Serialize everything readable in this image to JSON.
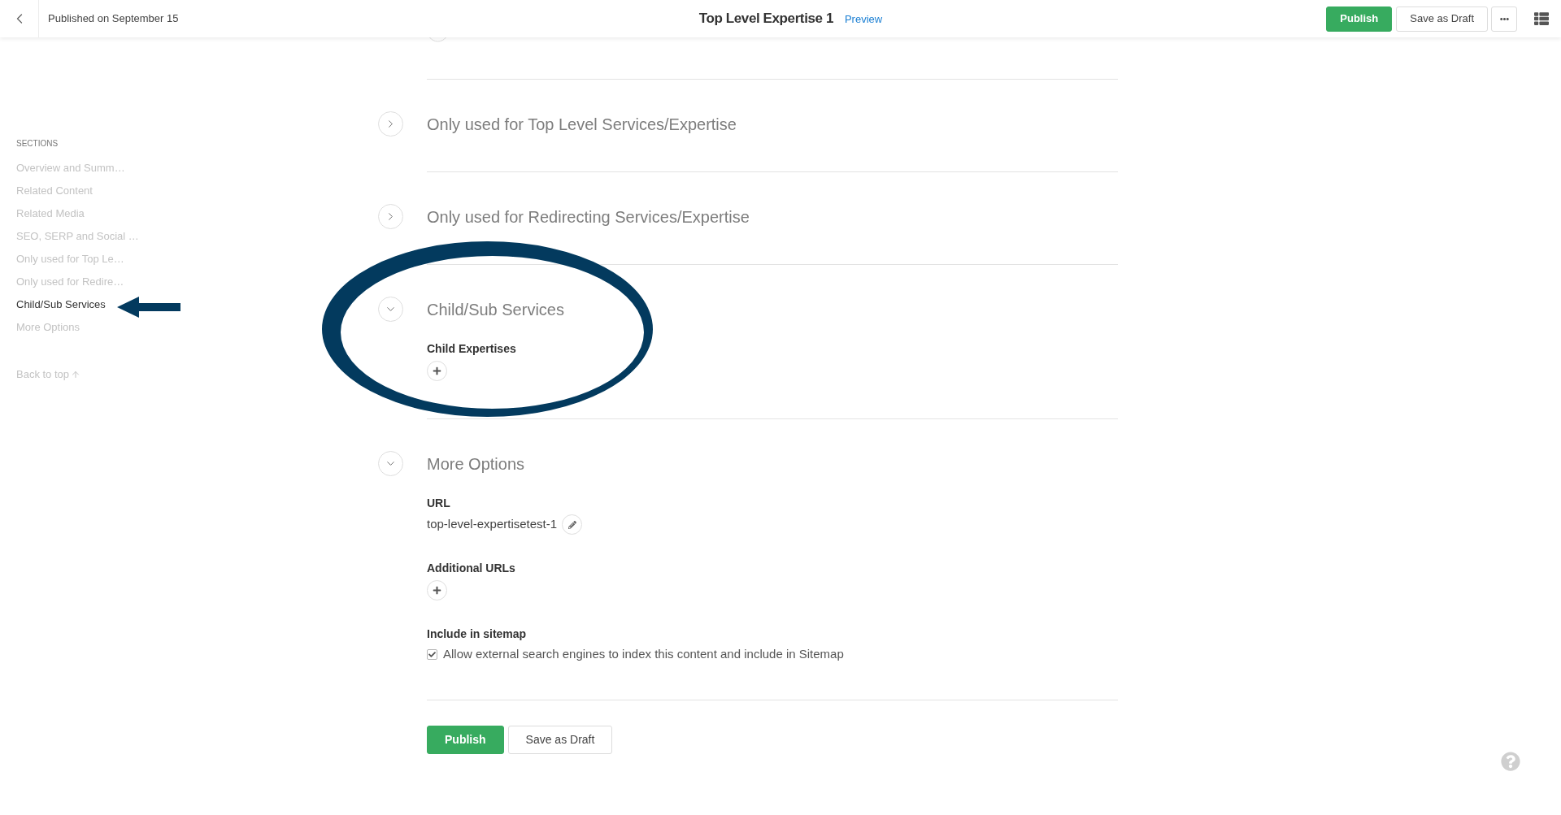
{
  "header": {
    "status": "Published on September 15",
    "title": "Top Level Expertise 1",
    "preview_link": "Preview",
    "buttons": [
      {
        "label": "Publish",
        "kind": "primary"
      },
      {
        "label": "Save as Draft",
        "kind": "secondary"
      }
    ]
  },
  "sidebar": {
    "heading": "SECTIONS",
    "items": [
      {
        "label": "Overview and Summ…",
        "selected": false
      },
      {
        "label": "Related Content",
        "selected": false
      },
      {
        "label": "Related Media",
        "selected": false
      },
      {
        "label": "SEO, SERP and Social …",
        "selected": false
      },
      {
        "label": "Only used for Top Le…",
        "selected": false
      },
      {
        "label": "Only used for Redire…",
        "selected": false
      },
      {
        "label": "Child/Sub Services",
        "selected": true
      },
      {
        "label": "More Options",
        "selected": false
      }
    ],
    "back_to_top": "Back to top"
  },
  "sections": [
    {
      "title": "Only used for Top Level Services/Expertise",
      "expanded": false
    },
    {
      "title": "Only used for Redirecting Services/Expertise",
      "expanded": false
    },
    {
      "title": "Child/Sub Services",
      "expanded": true,
      "fields": [
        {
          "kind": "list",
          "label": "Child Expertises"
        }
      ]
    },
    {
      "title": "More Options",
      "expanded": true,
      "fields": [
        {
          "kind": "url",
          "label": "URL",
          "value": "top-level-expertisetest-1"
        },
        {
          "kind": "list",
          "label": "Additional URLs"
        },
        {
          "kind": "checkbox",
          "label": "Include in sitemap",
          "option": "Allow external search engines to index this content and include in Sitemap",
          "checked": true
        }
      ]
    }
  ],
  "footer_buttons": [
    {
      "label": "Publish",
      "kind": "primary"
    },
    {
      "label": "Save as Draft",
      "kind": "secondary"
    }
  ]
}
